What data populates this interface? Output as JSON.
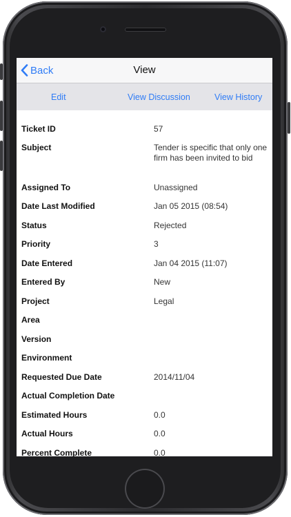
{
  "navbar": {
    "back_label": "Back",
    "title": "View"
  },
  "toolbar": {
    "edit_label": "Edit",
    "discussion_label": "View Discussion",
    "history_label": "View History"
  },
  "fields": [
    {
      "label": "Ticket ID",
      "value": "57"
    },
    {
      "label": "Subject",
      "value": "Tender is specific that only one firm has been invited to bid"
    },
    {
      "label": "Assigned To",
      "value": "Unassigned"
    },
    {
      "label": "Date Last Modified",
      "value": "Jan 05 2015 (08:54)"
    },
    {
      "label": "Status",
      "value": "Rejected"
    },
    {
      "label": "Priority",
      "value": "3"
    },
    {
      "label": "Date Entered",
      "value": "Jan 04 2015 (11:07)"
    },
    {
      "label": "Entered By",
      "value": "New"
    },
    {
      "label": "Project",
      "value": "Legal"
    },
    {
      "label": "Area",
      "value": ""
    },
    {
      "label": "Version",
      "value": ""
    },
    {
      "label": "Environment",
      "value": ""
    },
    {
      "label": "Requested Due Date",
      "value": "2014/11/04"
    },
    {
      "label": "Actual Completion Date",
      "value": ""
    },
    {
      "label": "Estimated Hours",
      "value": "0.0"
    },
    {
      "label": "Actual Hours",
      "value": "0.0"
    },
    {
      "label": "Percent Complete",
      "value": "0.0"
    }
  ],
  "colors": {
    "accent": "#2f7cf6",
    "navbar_bg": "#f7f7f8",
    "toolbar_bg": "#e4e4e8",
    "phone_body": "#2c2c2f"
  },
  "icons": {
    "back": "chevron-left-icon"
  }
}
